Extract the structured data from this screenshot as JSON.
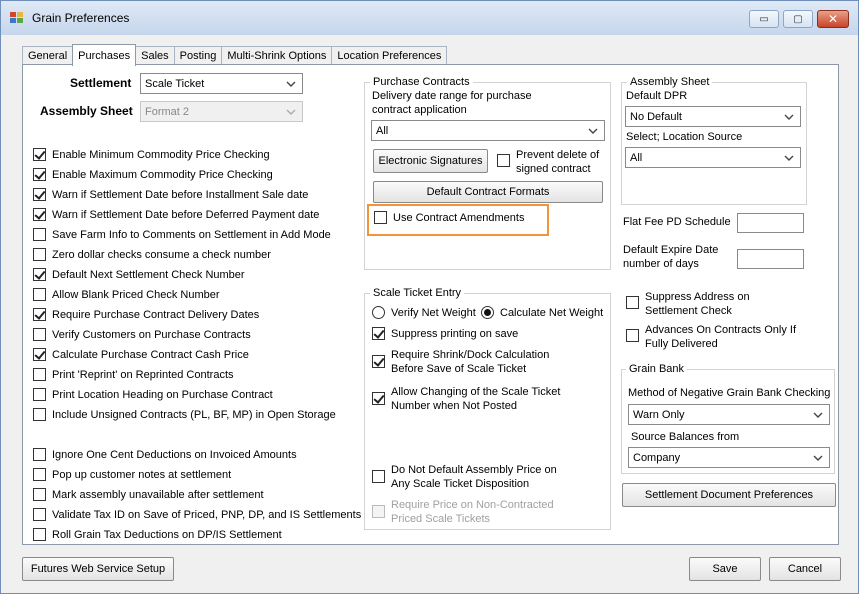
{
  "window": {
    "title": "Grain Preferences",
    "minimize": "▭",
    "maximize": "▢",
    "close": "✕"
  },
  "tabs": [
    "General",
    "Purchases",
    "Sales",
    "Posting",
    "Multi-Shrink Options",
    "Location Preferences"
  ],
  "left": {
    "settlement_label": "Settlement",
    "settlement_value": "Scale Ticket",
    "assembly_sheet_label": "Assembly Sheet",
    "assembly_sheet_value": "Format 2",
    "options": [
      {
        "label": "Enable Minimum Commodity Price Checking",
        "checked": true
      },
      {
        "label": "Enable Maximum Commodity Price Checking",
        "checked": true
      },
      {
        "label": "Warn if Settlement Date before  Installment Sale date",
        "checked": true
      },
      {
        "label": "Warn if Settlement Date before Deferred Payment date",
        "checked": true
      },
      {
        "label": "Save Farm Info to Comments on Settlement in Add Mode",
        "checked": false
      },
      {
        "label": "Zero dollar checks consume a check number",
        "checked": false
      },
      {
        "label": "Default Next Settlement Check Number",
        "checked": true
      },
      {
        "label": "Allow Blank Priced Check Number",
        "checked": false
      },
      {
        "label": "Require Purchase Contract Delivery Dates",
        "checked": true
      },
      {
        "label": "Verify Customers on Purchase Contracts",
        "checked": false
      },
      {
        "label": "Calculate Purchase Contract Cash Price",
        "checked": true
      },
      {
        "label": "Print 'Reprint' on Reprinted Contracts",
        "checked": false
      },
      {
        "label": "Print Location Heading on Purchase Contract",
        "checked": false
      },
      {
        "label": "Include Unsigned Contracts (PL, BF, MP) in Open Storage",
        "checked": false
      }
    ],
    "options2": [
      {
        "label": "Ignore One Cent Deductions on Invoiced Amounts",
        "checked": false
      },
      {
        "label": "Pop up customer notes at settlement",
        "checked": false
      },
      {
        "label": "Mark assembly unavailable after settlement",
        "checked": false
      },
      {
        "label": "Validate Tax ID on Save of Priced, PNP, DP, and IS Settlements",
        "checked": false
      },
      {
        "label": "Roll Grain Tax Deductions on DP/IS Settlement",
        "checked": false
      }
    ]
  },
  "purchase_contracts": {
    "title": "Purchase Contracts",
    "date_range_label_1": "Delivery date range for purchase",
    "date_range_label_2": "contract application",
    "date_range_value": "All",
    "electronic_signatures": "Electronic Signatures",
    "prevent_delete_1": "Prevent delete of",
    "prevent_delete_2": "signed contract",
    "default_formats": "Default Contract Formats",
    "use_amendments": "Use Contract Amendments"
  },
  "scale_ticket": {
    "title": "Scale Ticket Entry",
    "verify_net": "Verify Net Weight",
    "calculate_net": "Calculate Net Weight",
    "suppress_printing": "Suppress printing on save",
    "require_shrink_1": "Require Shrink/Dock Calculation",
    "require_shrink_2": "Before Save of Scale Ticket",
    "allow_changing_1": "Allow Changing of the Scale Ticket",
    "allow_changing_2": "Number when Not Posted",
    "no_default_price_1": "Do Not Default Assembly Price on",
    "no_default_price_2": "Any Scale Ticket Disposition",
    "require_price_1": "Require Price on Non-Contracted",
    "require_price_2": "Priced Scale Tickets"
  },
  "assembly_sheet": {
    "title": "Assembly Sheet",
    "default_dpr_label": "Default DPR",
    "default_dpr_value": "No Default",
    "location_source_label": "Select; Location Source",
    "location_source_value": "All"
  },
  "right": {
    "flat_fee_label": "Flat Fee PD Schedule",
    "flat_fee_value": "",
    "expire_label_1": "Default Expire Date",
    "expire_label_2": "number of days",
    "expire_value": "",
    "suppress_address_1": "Suppress Address on",
    "suppress_address_2": "Settlement Check",
    "advances_1": "Advances On Contracts Only If",
    "advances_2": "Fully Delivered"
  },
  "grain_bank": {
    "title": "Grain Bank",
    "method_label": "Method of Negative Grain Bank Checking",
    "method_value": "Warn Only",
    "source_label": "Source Balances from",
    "source_value": "Company"
  },
  "buttons": {
    "settlement_doc_prefs": "Settlement Document Preferences",
    "futures_setup": "Futures Web Service Setup",
    "save": "Save",
    "cancel": "Cancel"
  }
}
